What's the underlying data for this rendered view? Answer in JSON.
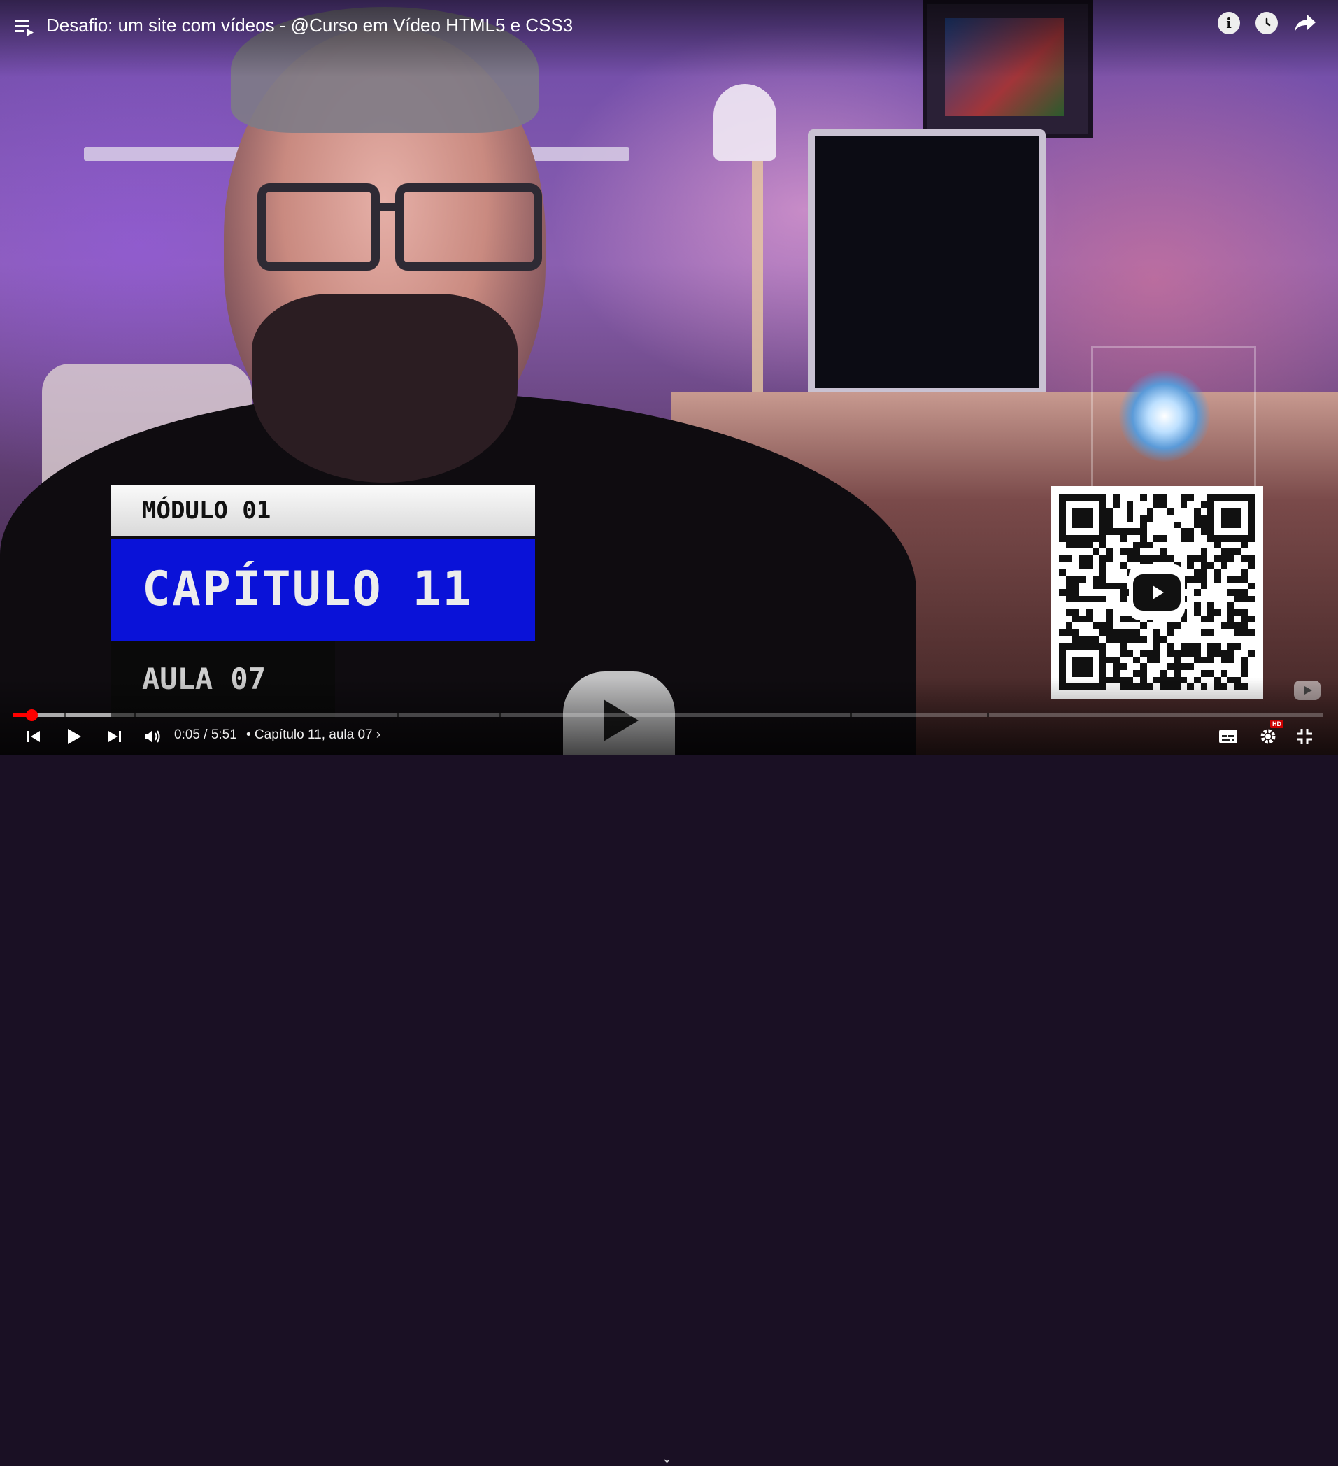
{
  "video": {
    "title": "Desafio: um site com vídeos - @Curso em Vídeo HTML5 e CSS3"
  },
  "overlay": {
    "module": "MÓDULO 01",
    "chapter": "CAPÍTULO 11",
    "lesson": "AULA 07"
  },
  "player": {
    "current_time": "0:05",
    "separator": " / ",
    "duration": "5:51",
    "chapter_label": "• Capítulo 11, aula 07 ›",
    "progress_fraction": 0.0142,
    "buffered_fraction": 0.075,
    "accent_color": "#ff0000",
    "quality_badge": "HD"
  },
  "icons": {
    "top": [
      "playlist-icon",
      "info-icon",
      "watch-later-icon",
      "share-icon"
    ],
    "bottom": [
      "previous-icon",
      "play-icon",
      "next-icon",
      "volume-icon",
      "subtitles-icon",
      "settings-icon",
      "exit-fullscreen-icon"
    ]
  }
}
